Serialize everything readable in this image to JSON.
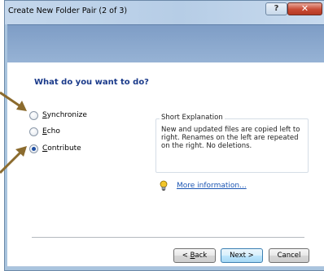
{
  "window": {
    "title": "Create New Folder Pair (2 of 3)",
    "help_button": "?",
    "close_button": "✕"
  },
  "prompt": {
    "heading": "What do you want to do?"
  },
  "options": [
    {
      "label": "Synchronize",
      "accel": "S",
      "rest": "ynchronize",
      "selected": false
    },
    {
      "label": "Echo",
      "accel": "E",
      "rest": "cho",
      "selected": false
    },
    {
      "label": "Contribute",
      "accel": "C",
      "rest": "ontribute",
      "selected": true
    }
  ],
  "explanation": {
    "title": "Short Explanation",
    "text": "New and updated files are copied left to right. Renames on the left are repeated on the right. No deletions."
  },
  "more_info": {
    "icon": "lightbulb-icon",
    "label": "More information..."
  },
  "buttons": {
    "back_accel": "B",
    "back_prefix": "< ",
    "back_rest": "ack",
    "next": "Next >",
    "cancel": "Cancel"
  },
  "colors": {
    "heading": "#1a3a8a",
    "link": "#1b55b3",
    "header_band": "#8aa8ce",
    "arrow": "#8b6b2e"
  }
}
